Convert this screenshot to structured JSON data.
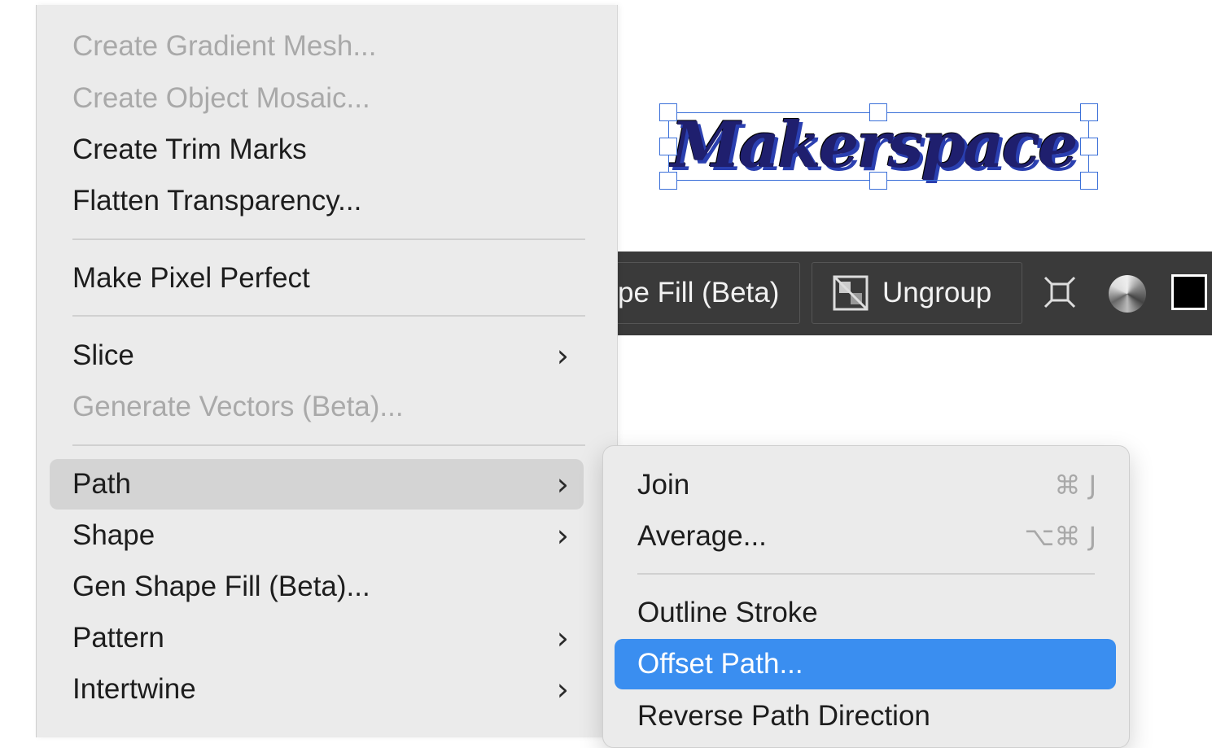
{
  "artwork": {
    "text": "Makerspace"
  },
  "taskbar": {
    "gen_fill_label": "pe Fill (Beta)",
    "ungroup_label": "Ungroup",
    "isolate_icon": "isolate-icon",
    "recolor_icon": "recolor-icon",
    "fill_color": "#000000"
  },
  "main_menu": {
    "items": [
      {
        "label": "Create Gradient Mesh...",
        "enabled": false
      },
      {
        "label": "Create Object Mosaic...",
        "enabled": false
      },
      {
        "label": "Create Trim Marks",
        "enabled": true
      },
      {
        "label": "Flatten Transparency...",
        "enabled": true
      },
      {
        "label": "Make Pixel Perfect",
        "enabled": true
      },
      {
        "label": "Slice",
        "enabled": true,
        "submenu": true
      },
      {
        "label": "Generate Vectors (Beta)...",
        "enabled": false
      },
      {
        "label": "Path",
        "enabled": true,
        "submenu": true,
        "selected": true
      },
      {
        "label": "Shape",
        "enabled": true,
        "submenu": true
      },
      {
        "label": "Gen Shape Fill (Beta)...",
        "enabled": true
      },
      {
        "label": "Pattern",
        "enabled": true,
        "submenu": true
      },
      {
        "label": "Intertwine",
        "enabled": true,
        "submenu": true
      }
    ],
    "chevron": "›"
  },
  "path_submenu": {
    "items": [
      {
        "label": "Join",
        "shortcut": "⌘ J"
      },
      {
        "label": "Average...",
        "shortcut": "⌥⌘ J"
      },
      {
        "label": "Outline Stroke",
        "shortcut": ""
      },
      {
        "label": "Offset Path...",
        "shortcut": "",
        "highlighted": true
      },
      {
        "label": "Reverse Path Direction",
        "shortcut": ""
      }
    ]
  },
  "colors": {
    "highlight": "#3a8ef0",
    "selection": "#3a6fd8",
    "menu_bg": "#ebebeb",
    "taskbar_bg": "#3a3a3a"
  }
}
